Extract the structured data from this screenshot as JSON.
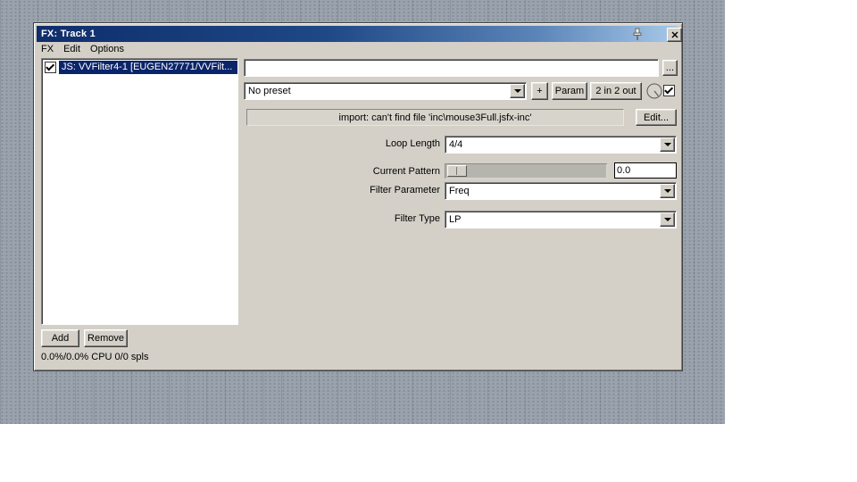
{
  "colors": {
    "desktop_base": "#9aa3ad",
    "window_face": "#d4d0c8",
    "titlebar_gradient_start": "#0f2d6b",
    "titlebar_gradient_end": "#a6c8e8",
    "selection": "#0a246a"
  },
  "window": {
    "title": "FX: Track 1",
    "menu": {
      "items": [
        "FX",
        "Edit",
        "Options"
      ]
    },
    "fx_list": {
      "item": {
        "label": "JS: VVFilter4-1 [EUGEN27771/VVFilt...",
        "checked": true,
        "selected": true
      }
    },
    "header_row": {
      "fx_name_value": "",
      "more_button": "..."
    },
    "preset_row": {
      "preset_value": "No preset",
      "plus": "+",
      "param": "Param",
      "io": "2 in 2 out",
      "wet_checkbox_checked": true
    },
    "import_row": {
      "message": "import: can't find file 'inc\\mouse3Full.jsfx-inc'",
      "edit": "Edit..."
    },
    "params": {
      "loop_length": {
        "label": "Loop Length",
        "value": "4/4"
      },
      "current_pattern": {
        "label": "Current Pattern",
        "value": "0.0",
        "slider_position": "min"
      },
      "filter_parameter": {
        "label": "Filter Parameter",
        "value": "Freq"
      },
      "filter_type": {
        "label": "Filter Type",
        "value": "LP"
      }
    },
    "footer": {
      "add": "Add",
      "remove": "Remove",
      "status": "0.0%/0.0% CPU 0/0 spls"
    }
  }
}
